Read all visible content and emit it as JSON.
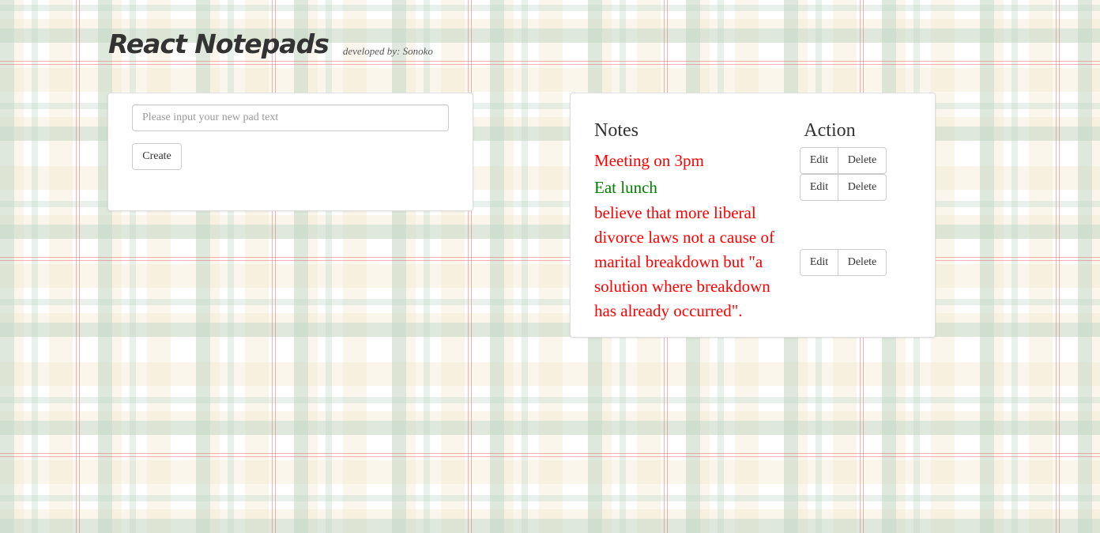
{
  "header": {
    "title": "React Notepads",
    "developer": "developed by: Sonoko"
  },
  "create": {
    "placeholder": "Please input your new pad text",
    "value": "",
    "button_label": "Create"
  },
  "notes": {
    "column_notes": "Notes",
    "column_action": "Action",
    "edit_label": "Edit",
    "delete_label": "Delete",
    "items": [
      {
        "text": "Meeting on 3pm",
        "color": "#ff0000"
      },
      {
        "text": "Eat lunch",
        "color": "#008000"
      },
      {
        "text": "believe that more liberal divorce laws not a cause of marital breakdown but \"a solution where breakdown has already occurred\".",
        "color": "#ff0000"
      }
    ]
  }
}
